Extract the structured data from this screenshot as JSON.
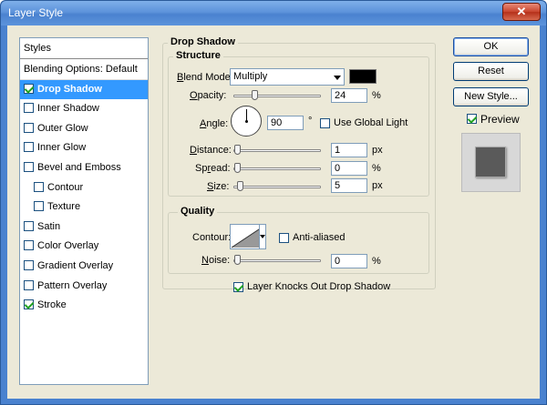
{
  "window": {
    "title": "Layer Style",
    "close": "✕"
  },
  "styles_panel": {
    "header": "Styles",
    "items": [
      {
        "label": "Blending Options: Default",
        "checkbox": false,
        "checked": false,
        "selected": false,
        "sub": false
      },
      {
        "label": "Drop Shadow",
        "checkbox": true,
        "checked": true,
        "selected": true,
        "sub": false
      },
      {
        "label": "Inner Shadow",
        "checkbox": true,
        "checked": false,
        "selected": false,
        "sub": false
      },
      {
        "label": "Outer Glow",
        "checkbox": true,
        "checked": false,
        "selected": false,
        "sub": false
      },
      {
        "label": "Inner Glow",
        "checkbox": true,
        "checked": false,
        "selected": false,
        "sub": false
      },
      {
        "label": "Bevel and Emboss",
        "checkbox": true,
        "checked": false,
        "selected": false,
        "sub": false
      },
      {
        "label": "Contour",
        "checkbox": true,
        "checked": false,
        "selected": false,
        "sub": true
      },
      {
        "label": "Texture",
        "checkbox": true,
        "checked": false,
        "selected": false,
        "sub": true
      },
      {
        "label": "Satin",
        "checkbox": true,
        "checked": false,
        "selected": false,
        "sub": false
      },
      {
        "label": "Color Overlay",
        "checkbox": true,
        "checked": false,
        "selected": false,
        "sub": false
      },
      {
        "label": "Gradient Overlay",
        "checkbox": true,
        "checked": false,
        "selected": false,
        "sub": false
      },
      {
        "label": "Pattern Overlay",
        "checkbox": true,
        "checked": false,
        "selected": false,
        "sub": false
      },
      {
        "label": "Stroke",
        "checkbox": true,
        "checked": true,
        "selected": false,
        "sub": false
      }
    ]
  },
  "drop_shadow": {
    "title": "Drop Shadow",
    "structure": {
      "title": "Structure",
      "blend_mode_label": "Blend Mode:",
      "blend_mode_value": "Multiply",
      "shadow_color": "#000000",
      "opacity_label": "Opacity:",
      "opacity_value": "24",
      "opacity_fraction": 0.24,
      "opacity_unit": "%",
      "angle_label": "Angle:",
      "angle_value": "90",
      "angle_unit": "°",
      "global_light_label": "Use Global Light",
      "global_light_checked": false,
      "distance_label": "Distance:",
      "distance_value": "1",
      "distance_unit": "px",
      "spread_label": "Spread:",
      "spread_value": "0",
      "spread_unit": "%",
      "size_label": "Size:",
      "size_value": "5",
      "size_unit": "px"
    },
    "quality": {
      "title": "Quality",
      "contour_label": "Contour:",
      "anti_aliased_label": "Anti-aliased",
      "anti_aliased_checked": false,
      "noise_label": "Noise:",
      "noise_value": "0",
      "noise_unit": "%"
    },
    "knockout_label": "Layer Knocks Out Drop Shadow",
    "knockout_checked": true
  },
  "buttons": {
    "ok": "OK",
    "reset": "Reset",
    "new_style": "New Style...",
    "preview_label": "Preview",
    "preview_checked": true
  }
}
